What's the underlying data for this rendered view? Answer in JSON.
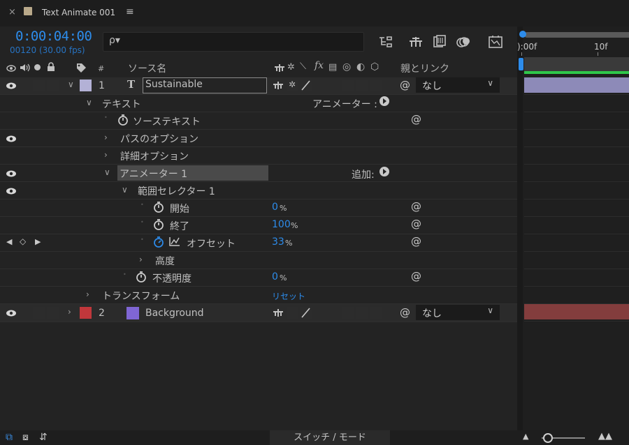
{
  "tab": {
    "close": "×",
    "title": "Text Animate 001",
    "menu": "≡"
  },
  "time": {
    "timecode": "0:00:04:00",
    "frames": "00120 (30.00 fps)"
  },
  "search": {
    "placeholder": "",
    "icon": "ρ▾"
  },
  "header": {
    "hash": "#",
    "source_name": "ソース名",
    "parent_link": "親とリンク",
    "fx": "fx"
  },
  "timeline": {
    "ruler_0": "):00f",
    "ruler_10": "10f"
  },
  "layers": [
    {
      "number": "1",
      "name": "Sustainable",
      "parent": "なし",
      "label_color": "#b3b1d6"
    },
    {
      "number": "2",
      "name": "Background",
      "parent": "なし",
      "label_color": "#c1373b",
      "swatch_color": "#7f66d4"
    }
  ],
  "props": {
    "text": "テキスト",
    "animator_label": "アニメーター :",
    "source_text": "ソーステキスト",
    "path_options": "パスのオプション",
    "more_options": "詳細オプション",
    "animator1": "アニメーター 1",
    "add_label": "追加:",
    "range_selector": "範囲セレクター 1",
    "start": "開始",
    "start_val": "0",
    "start_unit": "%",
    "end": "終了",
    "end_val": "100",
    "end_unit": "%",
    "offset": "オフセット",
    "offset_val": "33",
    "offset_unit": "%",
    "advanced": "高度",
    "opacity": "不透明度",
    "opacity_val": "0",
    "opacity_unit": "%",
    "transform": "トランスフォーム",
    "reset": "リセット"
  },
  "footer": {
    "switch_mode": "スイッチ / モード"
  },
  "colors": {
    "accent": "#2d8ceb",
    "bg": "#232323"
  }
}
